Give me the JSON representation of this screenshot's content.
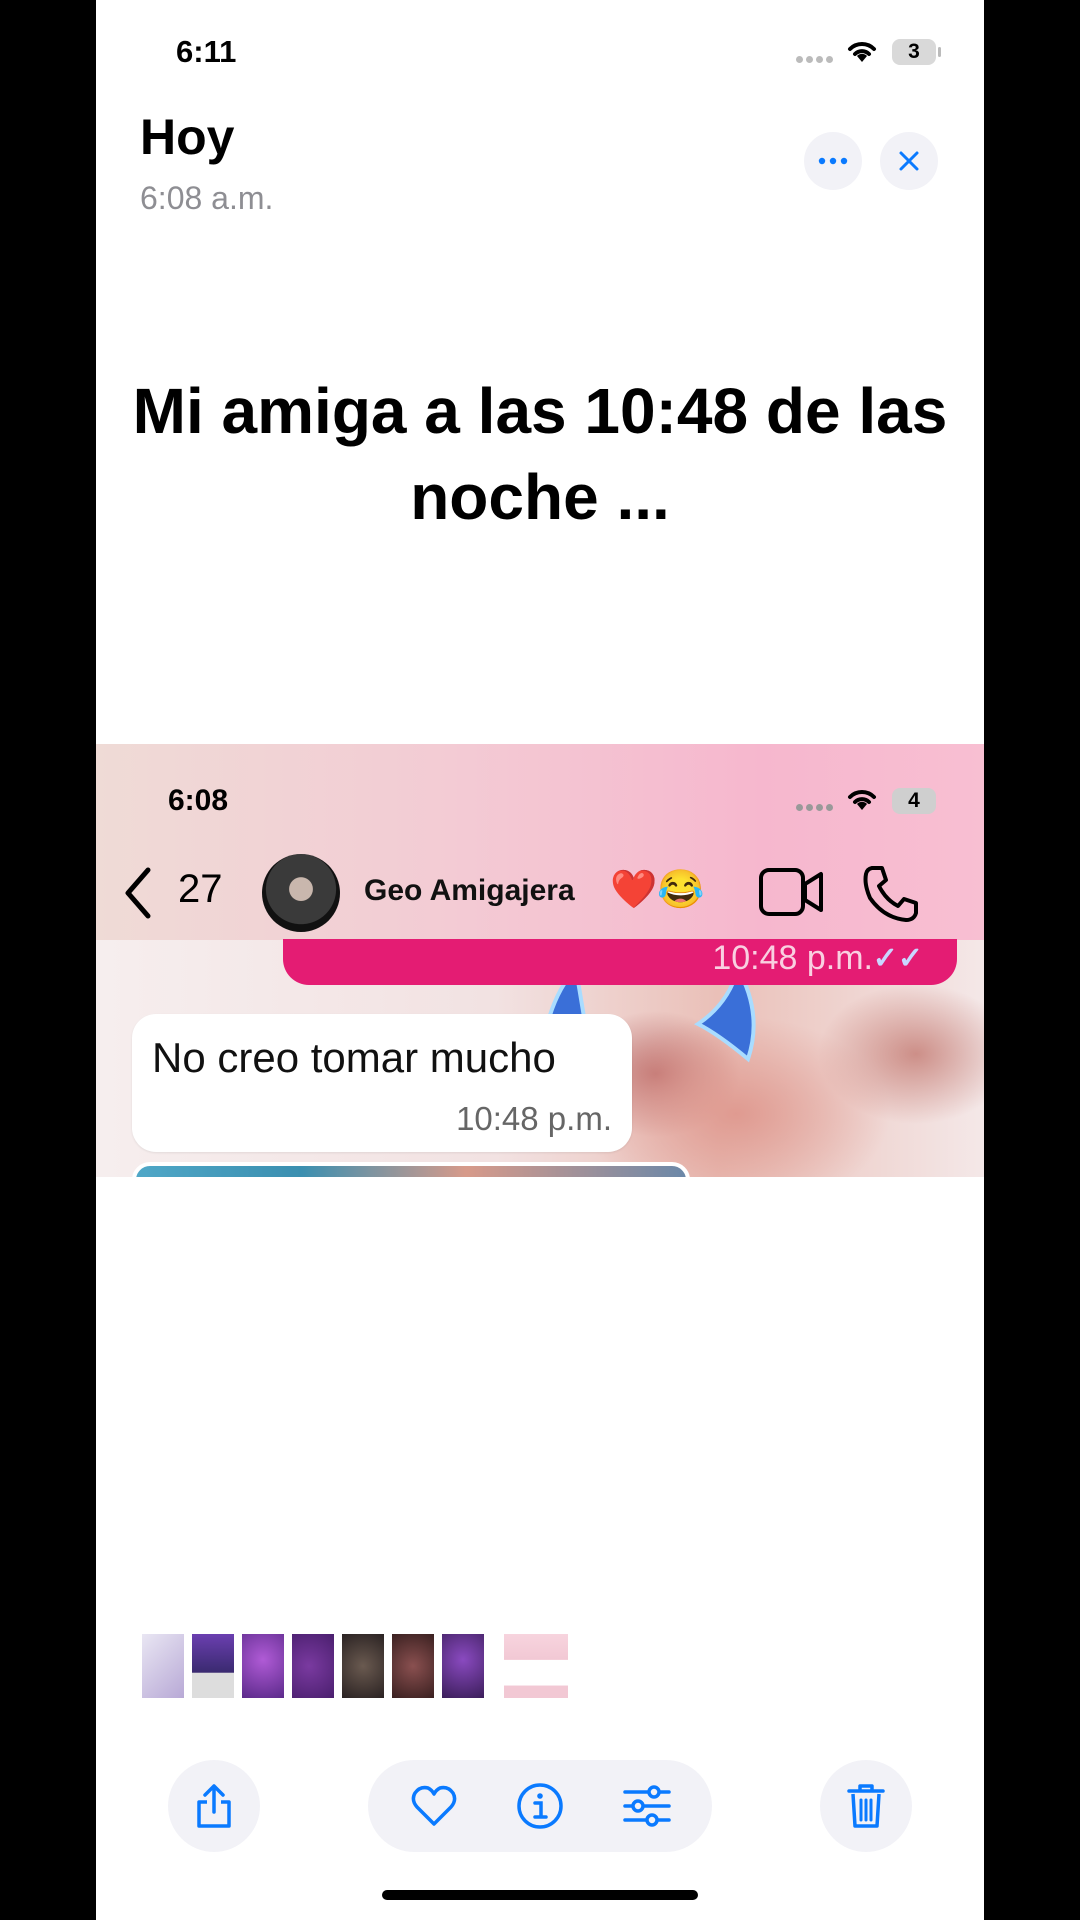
{
  "status_bar": {
    "time": "6:11",
    "battery": "3"
  },
  "header": {
    "title": "Hoy",
    "subtitle": "6:08 a.m."
  },
  "header_actions": {
    "more_icon": "ellipsis-icon",
    "close_icon": "close-icon"
  },
  "meme": {
    "caption": "Mi amiga a las 10:48 de las noche ..."
  },
  "embedded_screenshot": {
    "status_time": "6:08",
    "battery": "4",
    "back_count": "27",
    "contact_name": "Geo Amigajera",
    "contact_emoji": "❤️😂",
    "outgoing_time": "10:48 p.m.",
    "incoming_message": "No creo tomar mucho",
    "incoming_time": "10:48 p.m."
  },
  "thumbnails": [
    {
      "color": "#b8a9d6"
    },
    {
      "color": "#6b3fb0"
    },
    {
      "color": "#5b2a8a"
    },
    {
      "color": "#4a1f6e"
    },
    {
      "color": "#2a2222"
    },
    {
      "color": "#3a2020"
    },
    {
      "color": "#3b1e5a"
    },
    {
      "color": "#f2c8d4"
    }
  ],
  "toolbar": {
    "share_icon": "share-icon",
    "favorite_icon": "heart-icon",
    "info_icon": "info-icon",
    "adjust_icon": "sliders-icon",
    "delete_icon": "trash-icon",
    "accent": "#0a7aff"
  }
}
